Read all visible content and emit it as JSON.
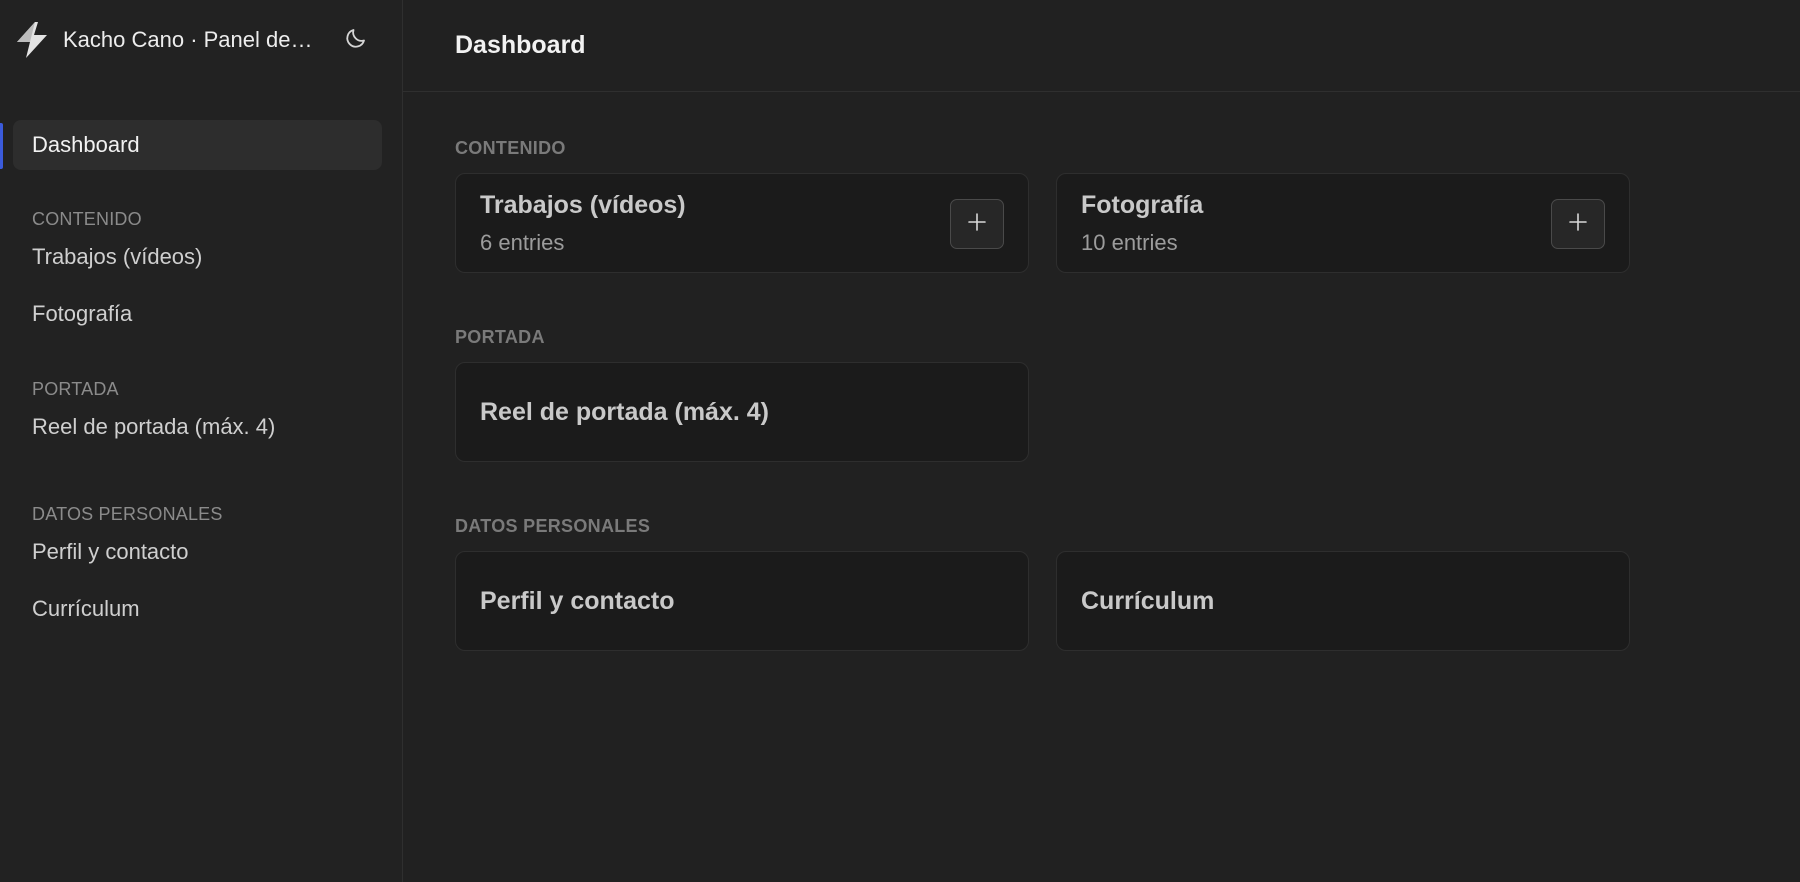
{
  "brand": {
    "title": "Kacho Cano · Panel de administración",
    "logo_icon": "bolt-icon",
    "theme_icon": "moon-icon"
  },
  "sidebar": {
    "active": "Dashboard",
    "sections": [
      {
        "label": "CONTENIDO",
        "items": [
          "Trabajos (vídeos)",
          "Fotografía"
        ]
      },
      {
        "label": "PORTADA",
        "items": [
          "Reel de portada (máx. 4)"
        ]
      },
      {
        "label": "DATOS PERSONALES",
        "items": [
          "Perfil y contacto",
          "Currículum"
        ]
      }
    ]
  },
  "main": {
    "title": "Dashboard",
    "sections": [
      {
        "label": "CONTENIDO",
        "cards": [
          {
            "title": "Trabajos (vídeos)",
            "subtitle": "6 entries",
            "add": true
          },
          {
            "title": "Fotografía",
            "subtitle": "10 entries",
            "add": true
          }
        ]
      },
      {
        "label": "PORTADA",
        "cards": [
          {
            "title": "Reel de portada (máx. 4)"
          }
        ]
      },
      {
        "label": "DATOS PERSONALES",
        "cards": [
          {
            "title": "Perfil y contacto"
          },
          {
            "title": "Currículum"
          }
        ]
      }
    ]
  },
  "colors": {
    "accent": "#3b5bdb",
    "background": "#212121",
    "card": "#1b1b1b"
  }
}
